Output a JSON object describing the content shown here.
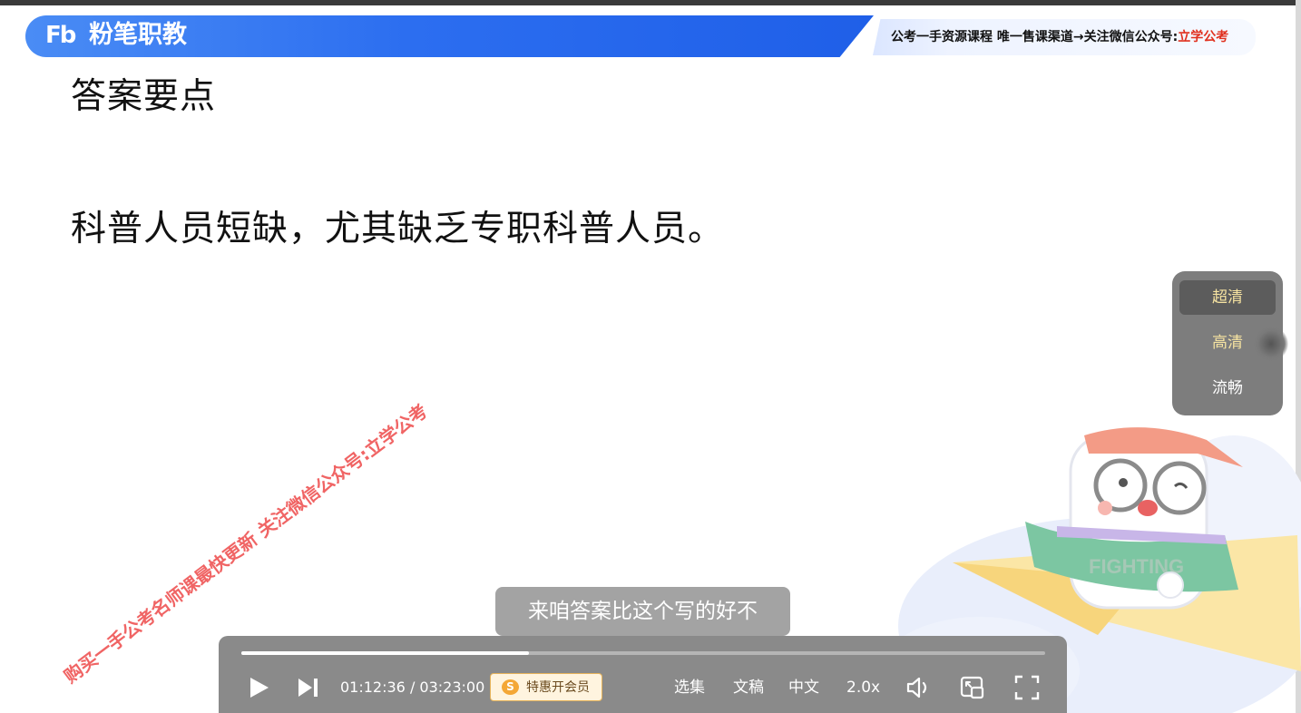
{
  "header": {
    "logo_mark": "Fb",
    "logo_text": "粉笔职教",
    "promo_prefix": "公考一手资源课程 唯一售课渠道→关注微信公众号:",
    "promo_accent": "立学公考"
  },
  "slide": {
    "title": "答案要点",
    "body": "科普人员短缺，尤其缺乏专职科普人员。"
  },
  "watermark": "购买一手公考名师课最快更新 关注微信公众号:立学公考",
  "quality_menu": {
    "items": [
      {
        "label": "超清",
        "state": "selected"
      },
      {
        "label": "高清",
        "state": "hover"
      },
      {
        "label": "流畅",
        "state": "normal"
      }
    ]
  },
  "subtitle": "来咱答案比这个写的好不",
  "player": {
    "time_display": "01:12:36 / 03:23:00",
    "current_time": "01:12:36",
    "total_time": "03:23:00",
    "progress_fraction": 0.358,
    "vip_button_label": "特惠开会员",
    "episodes_label": "选集",
    "transcript_label": "文稿",
    "subtitle_lang_label": "中文",
    "speed_label": "2.0x"
  },
  "mascot_text": "FIGHTING",
  "colors": {
    "brand_blue": "#2c6ef0",
    "watermark_red": "#ee4a4a",
    "selected_gold": "#f6e3a1"
  }
}
